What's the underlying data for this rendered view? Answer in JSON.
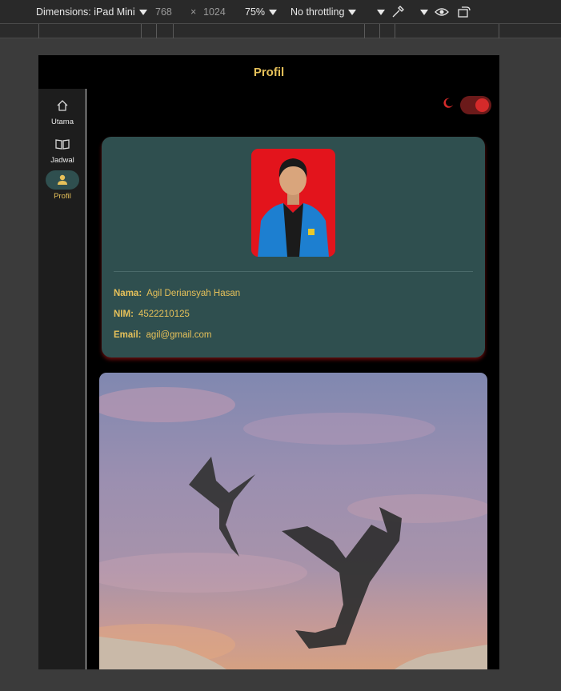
{
  "devtools": {
    "dimensions_label": "Dimensions: iPad Mini",
    "width": "768",
    "times": "×",
    "height": "1024",
    "zoom": "75%",
    "throttling": "No throttling"
  },
  "app": {
    "title": "Profil",
    "accent_color": "#e6c15a",
    "card_color": "#2f4f4f"
  },
  "nav": {
    "items": [
      {
        "label": "Utama",
        "icon": "home-icon",
        "active": false
      },
      {
        "label": "Jadwal",
        "icon": "book-icon",
        "active": false
      },
      {
        "label": "Profil",
        "icon": "person-icon",
        "active": true
      }
    ]
  },
  "theme_toggle": {
    "icon": "moon-icon",
    "on": true
  },
  "profile": {
    "photo": "profile-photo",
    "fields": [
      {
        "key": "Nama:",
        "value": "Agil Deriansyah Hasan"
      },
      {
        "key": "NIM:",
        "value": "4522210125"
      },
      {
        "key": "Email:",
        "value": "agil@gmail.com"
      }
    ]
  },
  "banner": {
    "image": "dragons-sky-banner"
  }
}
